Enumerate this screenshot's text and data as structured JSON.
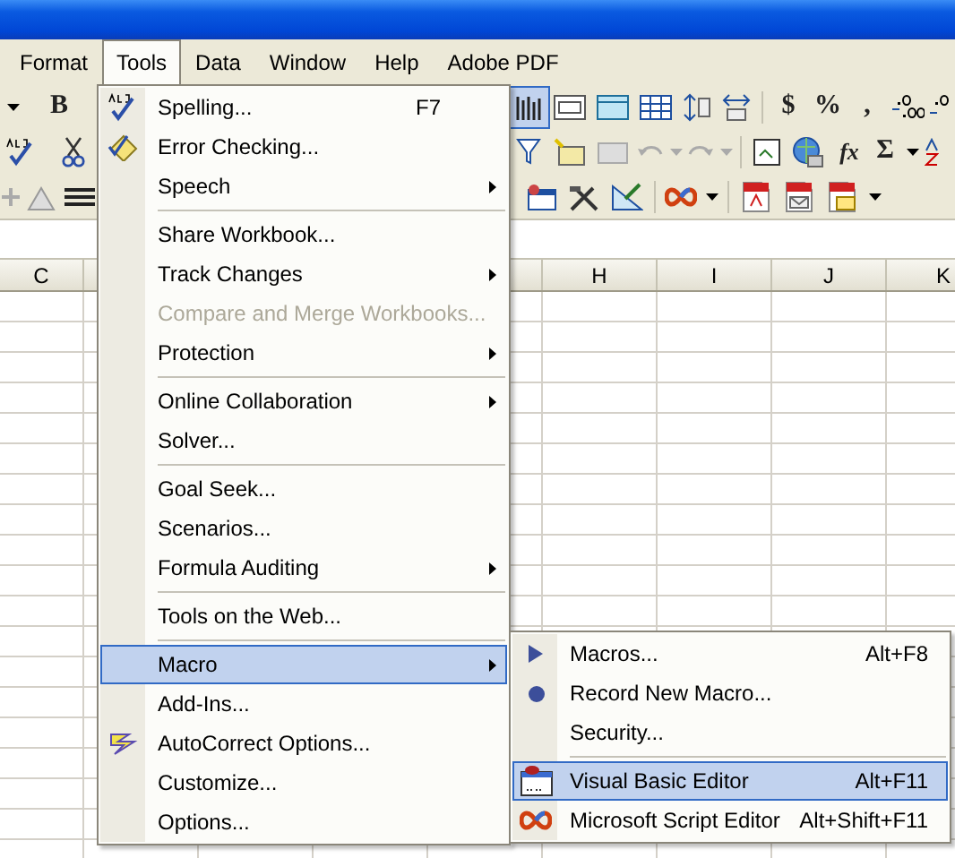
{
  "menu_bar": [
    {
      "label": "Format",
      "selected": false
    },
    {
      "label": "Tools",
      "selected": true
    },
    {
      "label": "Data",
      "selected": false
    },
    {
      "label": "Window",
      "selected": false
    },
    {
      "label": "Help",
      "selected": false
    },
    {
      "label": "Adobe PDF",
      "selected": false
    }
  ],
  "toolbars": [
    {
      "labels": [
        "B",
        "$",
        "%",
        ","
      ]
    },
    {
      "labels": [
        "fx",
        "Σ"
      ]
    }
  ],
  "column_headers": [
    "C",
    "H",
    "I",
    "J",
    "K"
  ],
  "tools_menu": {
    "sections": [
      [
        {
          "label": "Spelling...",
          "shortcut": "F7",
          "submenu": false,
          "disabled": false,
          "selected": false
        },
        {
          "label": "Error Checking...",
          "submenu": false,
          "disabled": false,
          "selected": false
        },
        {
          "label": "Speech",
          "submenu": true,
          "disabled": false,
          "selected": false
        }
      ],
      [
        {
          "label": "Share Workbook...",
          "submenu": false,
          "disabled": false,
          "selected": false
        },
        {
          "label": "Track Changes",
          "submenu": true,
          "disabled": false,
          "selected": false
        },
        {
          "label": "Compare and Merge Workbooks...",
          "submenu": false,
          "disabled": true,
          "selected": false
        },
        {
          "label": "Protection",
          "submenu": true,
          "disabled": false,
          "selected": false
        }
      ],
      [
        {
          "label": "Online Collaboration",
          "submenu": true,
          "disabled": false,
          "selected": false
        },
        {
          "label": "Solver...",
          "submenu": false,
          "disabled": false,
          "selected": false
        }
      ],
      [
        {
          "label": "Goal Seek...",
          "submenu": false,
          "disabled": false,
          "selected": false
        },
        {
          "label": "Scenarios...",
          "submenu": false,
          "disabled": false,
          "selected": false
        },
        {
          "label": "Formula Auditing",
          "submenu": true,
          "disabled": false,
          "selected": false
        }
      ],
      [
        {
          "label": "Tools on the Web...",
          "submenu": false,
          "disabled": false,
          "selected": false
        }
      ],
      [
        {
          "label": "Macro",
          "submenu": true,
          "disabled": false,
          "selected": true
        },
        {
          "label": "Add-Ins...",
          "submenu": false,
          "disabled": false,
          "selected": false
        },
        {
          "label": "AutoCorrect Options...",
          "submenu": false,
          "disabled": false,
          "selected": false
        },
        {
          "label": "Customize...",
          "submenu": false,
          "disabled": false,
          "selected": false
        },
        {
          "label": "Options...",
          "submenu": false,
          "disabled": false,
          "selected": false
        }
      ]
    ]
  },
  "macro_submenu": {
    "sections": [
      [
        {
          "label": "Macros...",
          "shortcut": "Alt+F8",
          "disabled": false,
          "selected": false
        },
        {
          "label": "Record New Macro...",
          "disabled": false,
          "selected": false
        },
        {
          "label": "Security...",
          "disabled": false,
          "selected": false
        }
      ],
      [
        {
          "label": "Visual Basic Editor",
          "shortcut": "Alt+F11",
          "disabled": false,
          "selected": true
        },
        {
          "label": "Microsoft Script Editor",
          "shortcut": "Alt+Shift+F11",
          "disabled": false,
          "selected": false
        }
      ]
    ]
  }
}
